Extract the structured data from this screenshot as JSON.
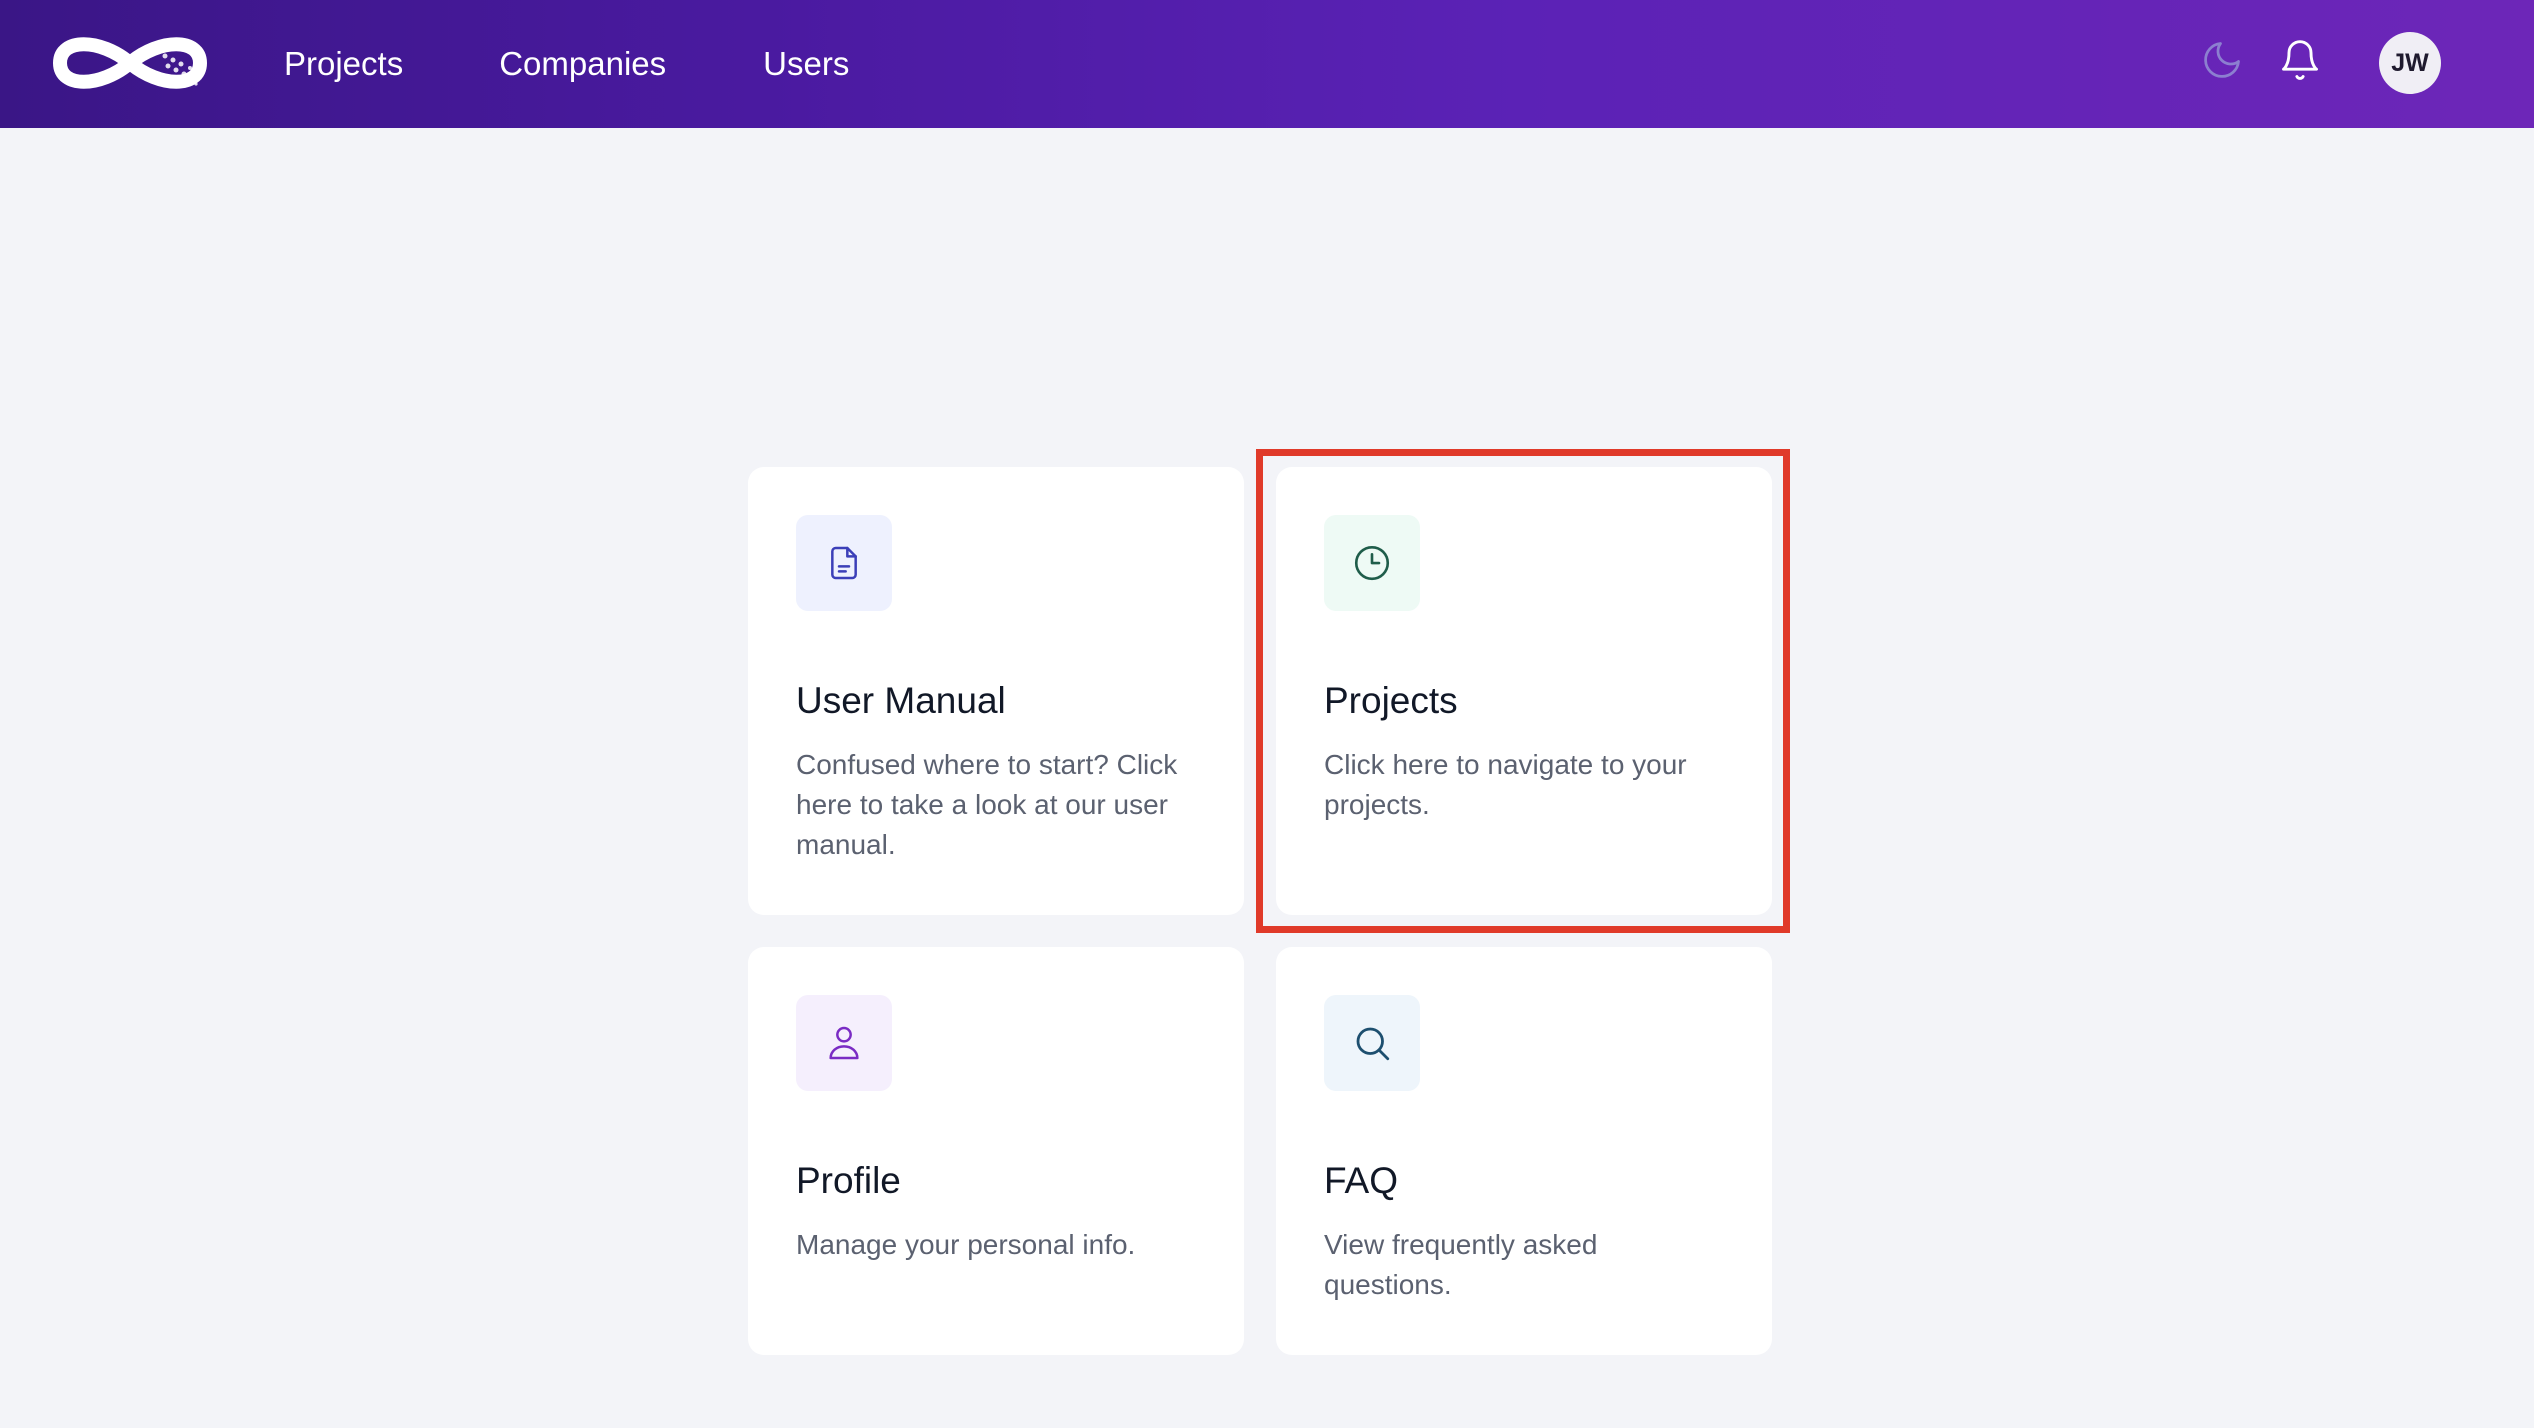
{
  "nav": {
    "items": [
      "Projects",
      "Companies",
      "Users"
    ]
  },
  "header": {
    "avatar_initials": "JW",
    "icons": [
      "moon-icon",
      "bell-icon"
    ]
  },
  "cards": [
    {
      "title": "User Manual",
      "description": "Confused where to start? Click here to take a look at our user manual.",
      "icon": "document-icon",
      "icon_bg": "#eef1fe",
      "icon_color": "#3b3fb8"
    },
    {
      "title": "Projects",
      "description": "Click here to navigate to your projects.",
      "icon": "clock-icon",
      "icon_bg": "#eefaf5",
      "icon_color": "#1f5d4a"
    },
    {
      "title": "Profile",
      "description": "Manage your personal info.",
      "icon": "user-icon",
      "icon_bg": "#f5effd",
      "icon_color": "#7a2bc4"
    },
    {
      "title": "FAQ",
      "description": "View frequently asked questions.",
      "icon": "search-icon",
      "icon_bg": "#eef5fb",
      "icon_color": "#1d4f6f"
    }
  ],
  "colors": {
    "header_gradient_start": "#3a1686",
    "header_gradient_end": "#6d26b8",
    "highlight": "#e03a2a",
    "page_bg": "#f3f4f8"
  }
}
